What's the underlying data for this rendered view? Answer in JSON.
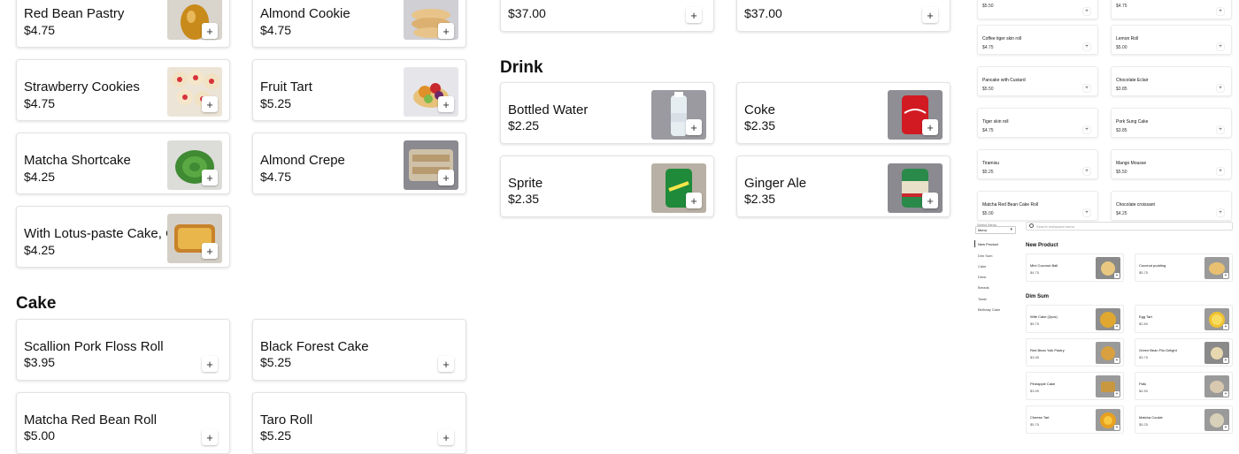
{
  "left_grid": {
    "pastries": [
      {
        "name": "Red Bean Pastry",
        "price": "$4.75",
        "image": "red-bean-pastry-photo"
      },
      {
        "name": "Almond Cookie",
        "price": "$4.75",
        "image": "almond-cookie-photo"
      },
      {
        "name": "Strawberry Cookies",
        "price": "$4.75",
        "image": "strawberry-cookies-photo"
      },
      {
        "name": "Fruit Tart",
        "price": "$5.25",
        "image": "fruit-tart-photo"
      },
      {
        "name": "Matcha Shortcake",
        "price": "$4.25",
        "image": "matcha-shortcake-photo"
      },
      {
        "name": "Almond Crepe",
        "price": "$4.75",
        "image": "almond-crepe-photo"
      },
      {
        "name": "With Lotus-paste Cake, Cake",
        "price": "$4.25",
        "image": "lotus-paste-cake-photo"
      }
    ],
    "cake_section_title": "Cake",
    "cakes": [
      {
        "name": "Scallion Pork Floss Roll",
        "price": "$3.95"
      },
      {
        "name": "Black Forest Cake",
        "price": "$5.25"
      },
      {
        "name": "Matcha Red Bean Roll",
        "price": "$5.00"
      },
      {
        "name": "Taro Roll",
        "price": "$5.25"
      }
    ]
  },
  "middle_grid": {
    "top_cards": [
      {
        "price": "$37.00"
      },
      {
        "price": "$37.00"
      }
    ],
    "drink_section_title": "Drink",
    "drinks": [
      {
        "name": "Bottled Water",
        "price": "$2.25",
        "image": "bottled-water-photo"
      },
      {
        "name": "Coke",
        "price": "$2.35",
        "image": "coke-can-photo"
      },
      {
        "name": "Sprite",
        "price": "$2.35",
        "image": "sprite-can-photo"
      },
      {
        "name": "Ginger Ale",
        "price": "$2.35",
        "image": "ginger-ale-can-photo"
      }
    ]
  },
  "mini_panel": {
    "items": [
      {
        "name": "",
        "price": "$5.50"
      },
      {
        "name": "",
        "price": "$4.75"
      },
      {
        "name": "Coffee tiger skin roll",
        "price": "$4.75"
      },
      {
        "name": "Lemon Roll",
        "price": "$5.00"
      },
      {
        "name": "Pancake with Custard",
        "price": "$5.50"
      },
      {
        "name": "Chocolate Eclair",
        "price": "$3.85"
      },
      {
        "name": "Tiger skin roll",
        "price": "$4.75"
      },
      {
        "name": "Pork Sung Cake",
        "price": "$3.85"
      },
      {
        "name": "Tiramisu",
        "price": "$5.25"
      },
      {
        "name": "Mango Mousse",
        "price": "$5.50"
      },
      {
        "name": "Matcha Red Bean Cake Roll",
        "price": "$5.00"
      },
      {
        "name": "Chocolate croissant",
        "price": "$4.25"
      }
    ]
  },
  "tiny_app": {
    "select_label": "Select Menu",
    "select_value": "Menu",
    "search_placeholder": "Search restaurant menu",
    "nav": [
      "New Product",
      "Dim Sum",
      "Cake",
      "Drink",
      "Breads",
      "Toast",
      "Birthday Cake"
    ],
    "new_product_title": "New Product",
    "new_products": [
      {
        "name": "Mini Coconut Ball",
        "price": "$4.75"
      },
      {
        "name": "Coconut pudding",
        "price": "$5.75"
      }
    ],
    "dim_sum_title": "Dim Sum",
    "dim_sum": [
      {
        "name": "Wife Cake (2pcs)",
        "price": "$5.75"
      },
      {
        "name": "Egg Tart",
        "price": "$2.80"
      },
      {
        "name": "Red Bean Yolk Pastry",
        "price": "$3.95"
      },
      {
        "name": "Green Bean Filo Delight",
        "price": "$3.75"
      },
      {
        "name": "Pineapple Cake",
        "price": "$3.95"
      },
      {
        "name": "Pafu",
        "price": "$4.50"
      },
      {
        "name": "Cheese Tart",
        "price": "$5.75"
      },
      {
        "name": "Matcha Cookie",
        "price": "$5.25"
      }
    ]
  },
  "colors": {
    "card_border": "#e3e3e3",
    "text": "#111111",
    "background": "#ffffff"
  },
  "add_symbol": "+"
}
